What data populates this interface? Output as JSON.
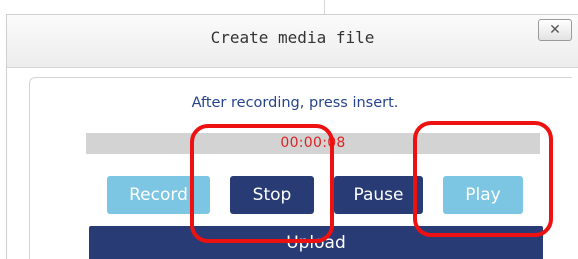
{
  "dialog": {
    "title": "Create media file",
    "close_label": "✕"
  },
  "recorder": {
    "instruction": "After recording, press insert.",
    "timer": "00:00:08",
    "buttons": {
      "record": "Record",
      "stop": "Stop",
      "pause": "Pause",
      "play": "Play",
      "upload": "Upload"
    }
  },
  "colors": {
    "primary_button": "#283b74",
    "disabled_button": "#7cc6e4",
    "timer_text": "#dd2222",
    "instruction_text": "#27448a",
    "highlight": "#ee1111"
  },
  "icons": {
    "close": "close-icon"
  }
}
